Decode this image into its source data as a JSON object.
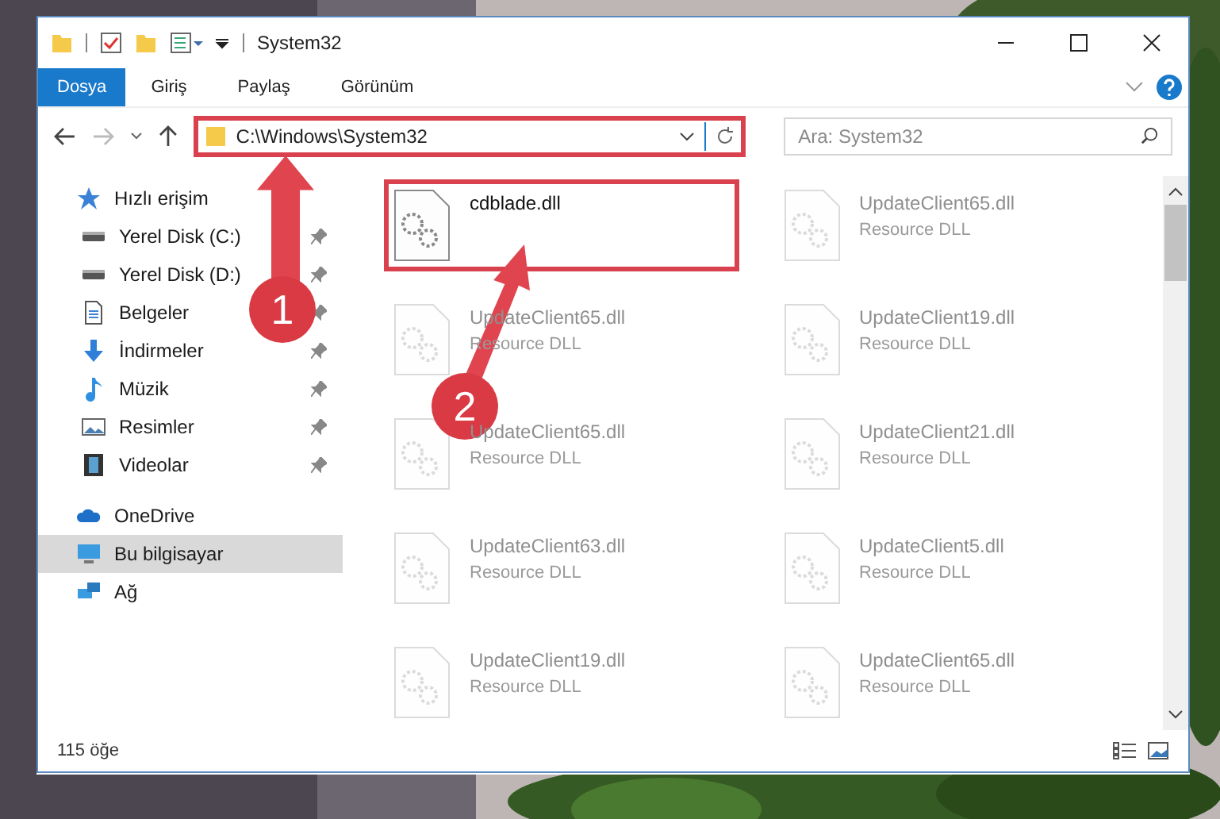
{
  "window": {
    "title": "System32"
  },
  "ribbon_tabs": [
    {
      "label": "Dosya",
      "selected": true
    },
    {
      "label": "Giriş",
      "selected": false
    },
    {
      "label": "Paylaş",
      "selected": false
    },
    {
      "label": "Görünüm",
      "selected": false
    }
  ],
  "address_bar": {
    "path": "C:\\Windows\\System32",
    "highlighted": true
  },
  "search": {
    "placeholder": "Ara: System32"
  },
  "sidebar": {
    "items": [
      {
        "label": "Hızlı erişim",
        "kind": "star",
        "pinned": false,
        "selected": false,
        "children": [
          {
            "label": "Yerel Disk (C:)",
            "kind": "drive",
            "pinned": true,
            "selected": false
          },
          {
            "label": "Yerel Disk (D:)",
            "kind": "drive",
            "pinned": true,
            "selected": false
          },
          {
            "label": "Belgeler",
            "kind": "document",
            "pinned": true,
            "selected": false
          },
          {
            "label": "İndirmeler",
            "kind": "download",
            "pinned": true,
            "selected": false
          },
          {
            "label": "Müzik",
            "kind": "music",
            "pinned": true,
            "selected": false
          },
          {
            "label": "Resimler",
            "kind": "pictures",
            "pinned": true,
            "selected": false
          },
          {
            "label": "Videolar",
            "kind": "video",
            "pinned": true,
            "selected": false
          }
        ]
      },
      {
        "label": "OneDrive",
        "kind": "cloud",
        "pinned": false,
        "selected": false
      },
      {
        "label": "Bu bilgisayar",
        "kind": "computer",
        "pinned": false,
        "selected": true
      },
      {
        "label": "Ağ",
        "kind": "network",
        "pinned": false,
        "selected": false
      }
    ]
  },
  "files": [
    {
      "name": "cdblade.dll",
      "dimmed": false,
      "highlighted": true
    },
    {
      "name": "UpdateClient65.dll",
      "type": "Resource DLL",
      "dimmed": true,
      "highlighted": false
    },
    {
      "name": "UpdateClient65.dll",
      "type": "Resource DLL",
      "dimmed": true,
      "highlighted": false
    },
    {
      "name": "UpdateClient19.dll",
      "type": "Resource DLL",
      "dimmed": true,
      "highlighted": false
    },
    {
      "name": "UpdateClient65.dll",
      "type": "Resource DLL",
      "dimmed": true,
      "highlighted": false
    },
    {
      "name": "UpdateClient21.dll",
      "type": "Resource DLL",
      "dimmed": true,
      "highlighted": false
    },
    {
      "name": "UpdateClient63.dll",
      "type": "Resource DLL",
      "dimmed": true,
      "highlighted": false
    },
    {
      "name": "UpdateClient5.dll",
      "type": "Resource DLL",
      "dimmed": true,
      "highlighted": false
    },
    {
      "name": "UpdateClient19.dll",
      "type": "Resource DLL",
      "dimmed": true,
      "highlighted": false
    },
    {
      "name": "UpdateClient65.dll",
      "type": "Resource DLL",
      "dimmed": true,
      "highlighted": false
    }
  ],
  "status_bar": {
    "count": "115 öğe"
  },
  "callouts": [
    {
      "number": "1"
    },
    {
      "number": "2"
    }
  ]
}
